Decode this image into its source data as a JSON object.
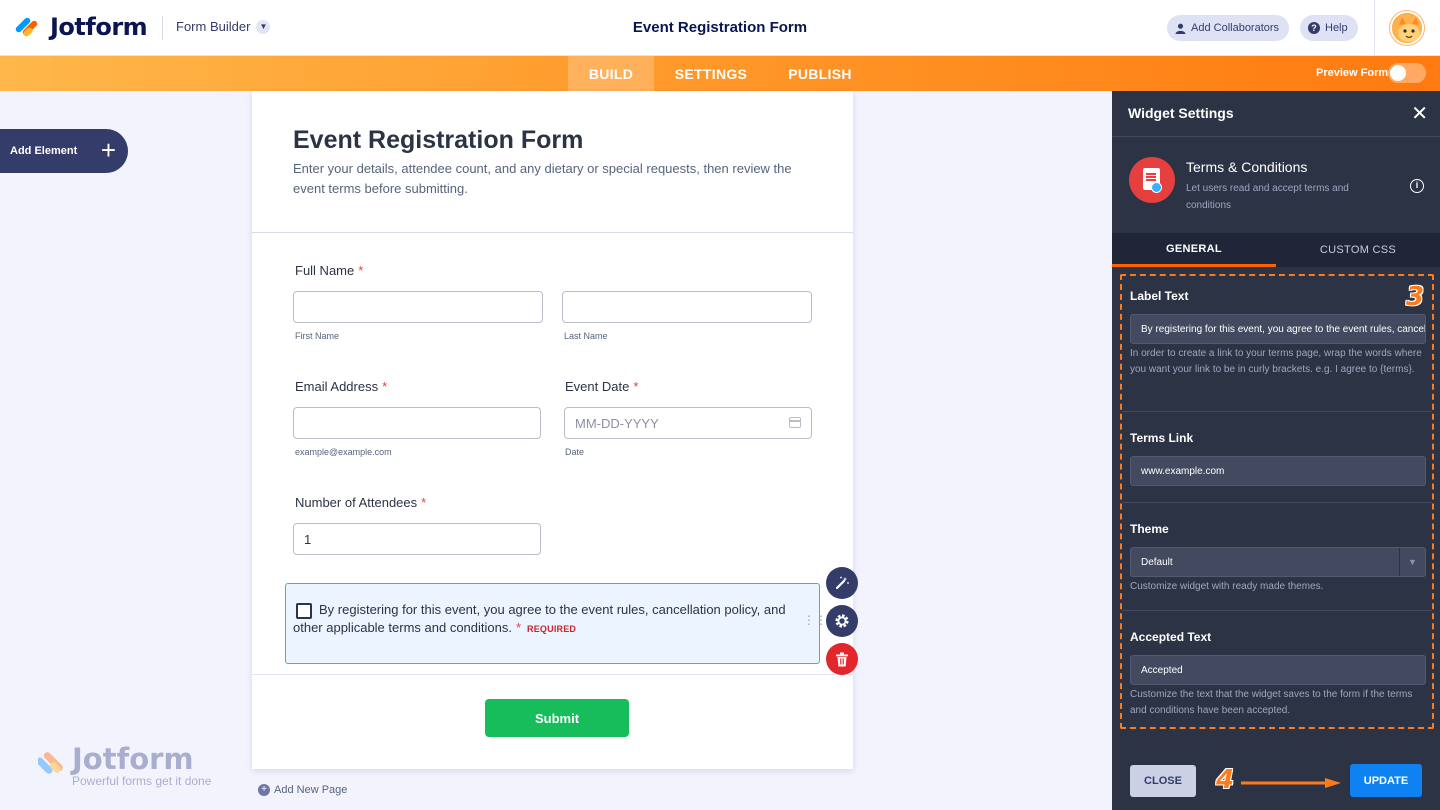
{
  "header": {
    "brand": "Jotform",
    "builder_label": "Form Builder",
    "title": "Event Registration Form",
    "add_collaborators": "Add Collaborators",
    "help": "Help"
  },
  "nav": {
    "tabs": [
      "BUILD",
      "SETTINGS",
      "PUBLISH"
    ],
    "active_tab": "BUILD",
    "preview_label": "Preview Form",
    "preview_on": false
  },
  "left": {
    "add_element": "Add Element"
  },
  "form": {
    "title": "Event Registration Form",
    "description": "Enter your details, attendee count, and any dietary or special requests, then review the event terms before submitting.",
    "required_mark": "*",
    "full_name": {
      "label": "Full Name",
      "first_sub": "First Name",
      "last_sub": "Last Name"
    },
    "email": {
      "label": "Email Address",
      "sub": "example@example.com"
    },
    "event_date": {
      "label": "Event Date",
      "placeholder": "MM-DD-YYYY",
      "sub": "Date"
    },
    "attendees": {
      "label": "Number of Attendees",
      "value": "1"
    },
    "terms": {
      "text": "By registering for this event, you agree to the event rules, cancellation policy, and other applicable terms and conditions.",
      "required_tag": "REQUIRED",
      "checked": false
    },
    "submit": "Submit",
    "add_new_page": "Add New Page"
  },
  "watermark": {
    "brand": "Jotform",
    "tagline": "Powerful forms get it done"
  },
  "panel": {
    "title": "Widget Settings",
    "widget_name": "Terms & Conditions",
    "widget_desc": "Let users read and accept terms and conditions",
    "tabs": [
      "GENERAL",
      "CUSTOM CSS"
    ],
    "active_tab": "GENERAL",
    "label_text": {
      "label": "Label Text",
      "value": "By registering for this event, you agree to the event rules, cancellation policy, and other applicable terms and conditions.",
      "help": "In order to create a link to your terms page, wrap the words where you want your link to be in curly brackets. e.g. I agree to {terms}."
    },
    "terms_link": {
      "label": "Terms Link",
      "value": "www.example.com"
    },
    "theme": {
      "label": "Theme",
      "value": "Default",
      "help": "Customize widget with ready made themes."
    },
    "accepted_text": {
      "label": "Accepted Text",
      "value": "Accepted",
      "help": "Customize the text that the widget saves to the form if the terms and conditions have been accepted."
    },
    "close_button": "CLOSE",
    "update_button": "UPDATE"
  },
  "annotations": {
    "step_3": "3",
    "step_4": "4"
  },
  "colors": {
    "accent_orange": "#ff7a10",
    "panel_bg": "#2c3345",
    "submit_green": "#18bd5b",
    "update_blue": "#0e82f2",
    "selected_bg": "#ebf4ff",
    "required_red": "#f23a3c"
  }
}
